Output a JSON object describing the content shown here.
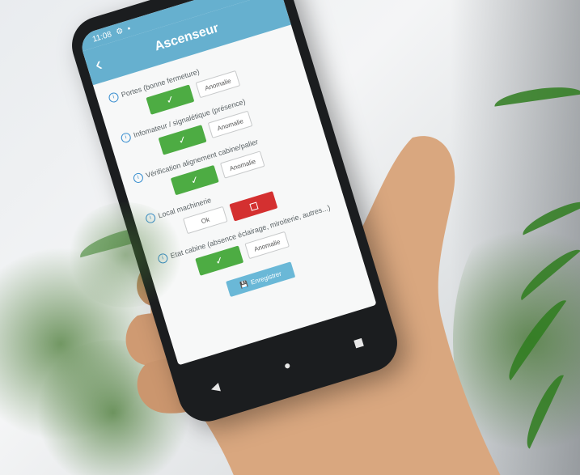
{
  "status": {
    "time": "11:08"
  },
  "app": {
    "title": "Ascenseur",
    "back_icon": "‹"
  },
  "items": [
    {
      "label": "Portes (bonne fermeture)",
      "ok": "✓",
      "anomaly": "Anomalie"
    },
    {
      "label": "Infomateur / signalétique (présence)",
      "ok": "✓",
      "anomaly": "Anomalie"
    },
    {
      "label": "Vérification alignement cabine/palier",
      "ok": "✓",
      "anomaly": "Anomalie"
    },
    {
      "label": "Local machinerie",
      "ok": "Ok",
      "anomaly": ""
    },
    {
      "label": "Etat cabine (absence éclairage, miroiterie, autres...)",
      "ok": "✓",
      "anomaly": "Anomalie"
    }
  ],
  "save": {
    "label": "Enregistrer",
    "icon": "save-icon"
  },
  "colors": {
    "primary": "#66b0cf",
    "ok": "#4dac43",
    "alert": "#d43030"
  }
}
